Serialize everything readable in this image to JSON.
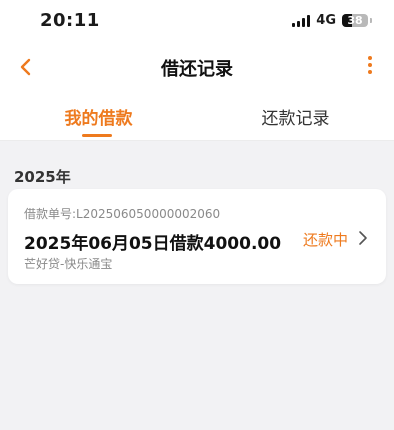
{
  "status_bar": {
    "time": "20:11",
    "network": "4G",
    "battery": "38"
  },
  "nav": {
    "title": "借还记录",
    "back_icon": "chevron-left-icon",
    "more_icon": "more-vertical-icon"
  },
  "tabs": [
    {
      "label": "我的借款",
      "active": true
    },
    {
      "label": "还款记录",
      "active": false
    }
  ],
  "year_group": "2025年",
  "loans": [
    {
      "loan_no": "借款单号:L202506050000002060",
      "title": "2025年06月05日借款4000.00",
      "product": "芒好贷-快乐通宝",
      "status": "还款中"
    }
  ],
  "colors": {
    "accent": "#ee7a1e",
    "background": "#f2f2f4",
    "card": "#ffffff"
  }
}
